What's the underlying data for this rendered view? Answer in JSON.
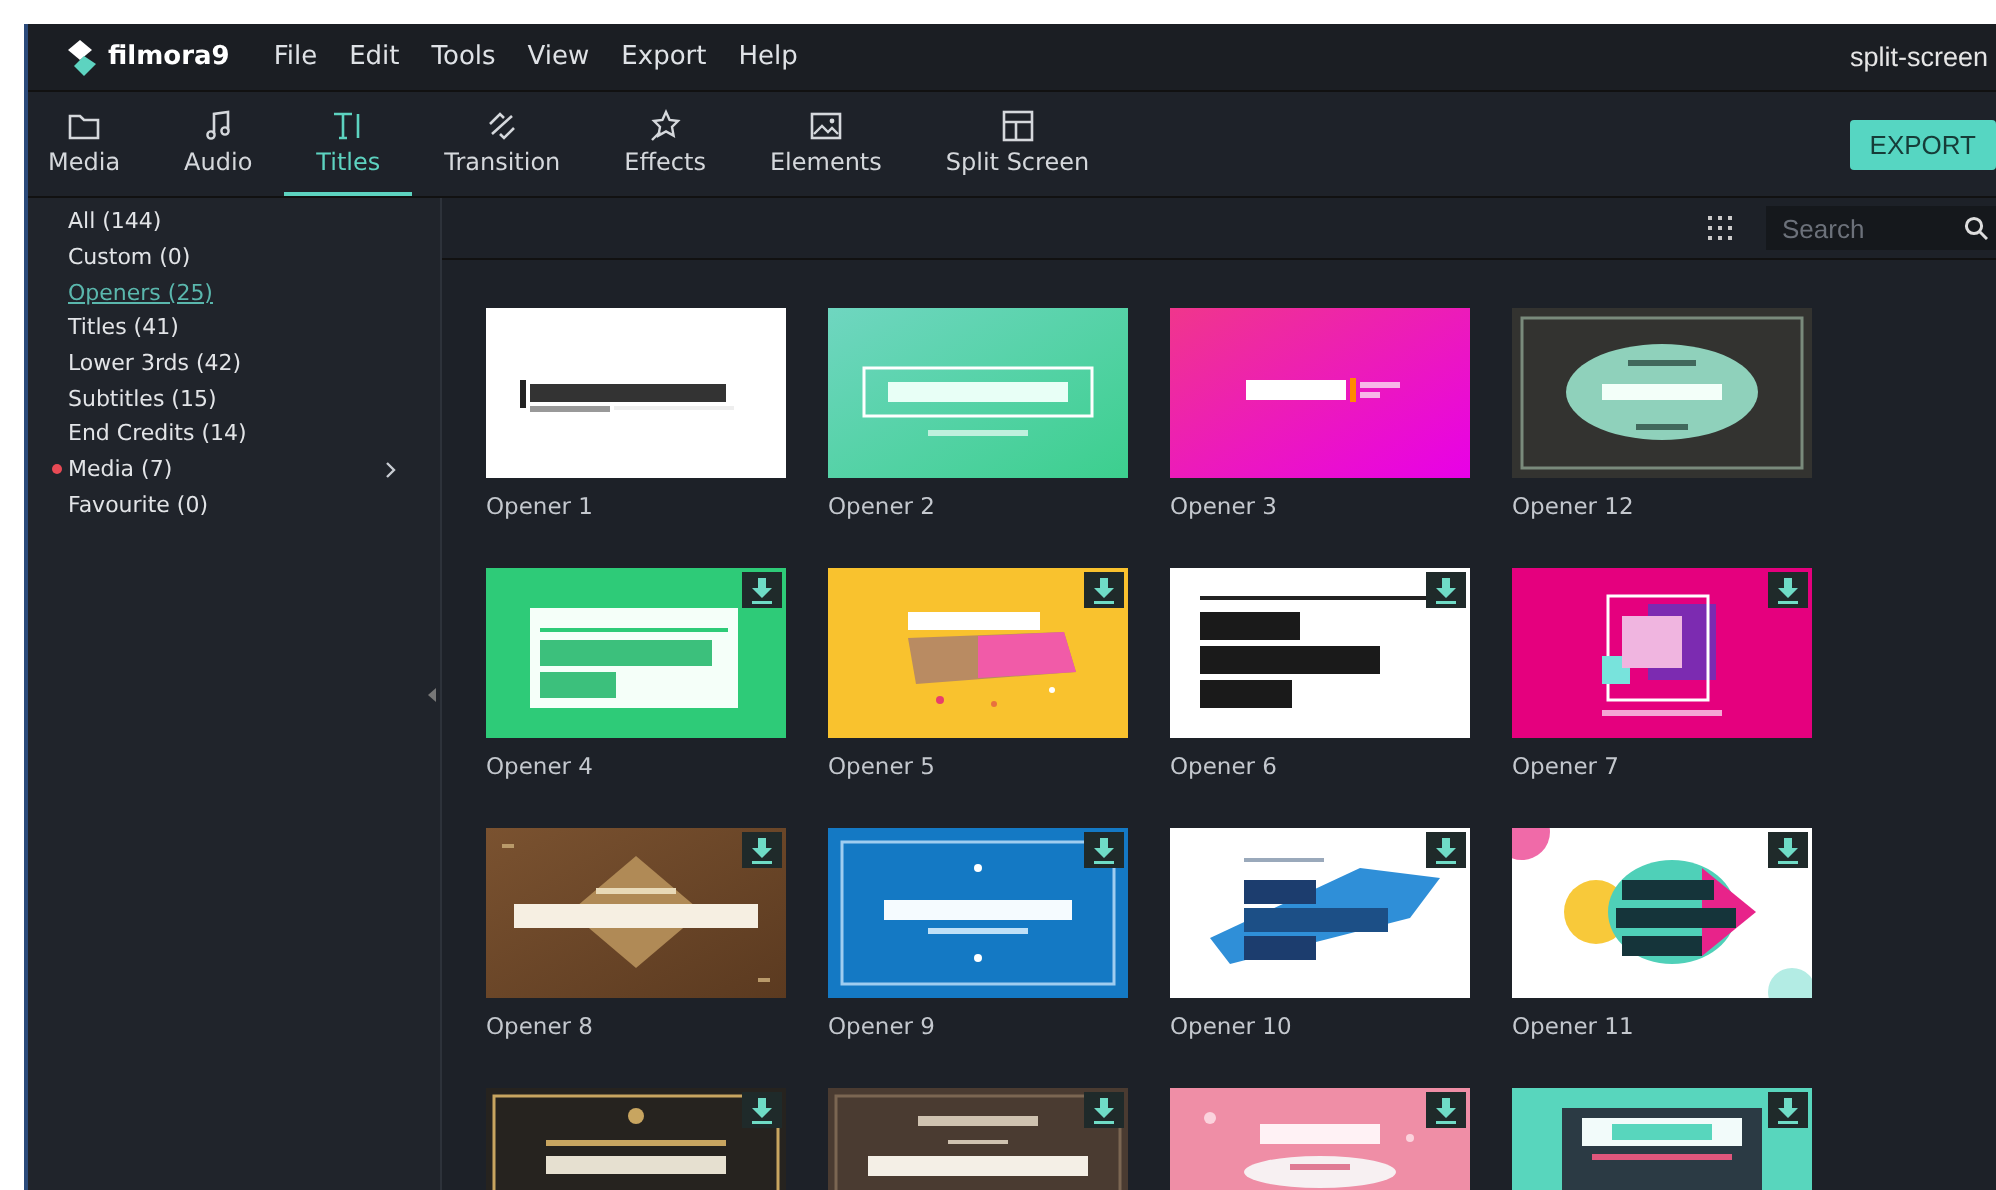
{
  "window": {
    "app_name": "filmora9",
    "menu": [
      "File",
      "Edit",
      "Tools",
      "View",
      "Export",
      "Help"
    ],
    "project_title": "split-screen"
  },
  "toolbar": {
    "tabs": [
      {
        "label": "Media",
        "selected": false
      },
      {
        "label": "Audio",
        "selected": false
      },
      {
        "label": "Titles",
        "selected": true
      },
      {
        "label": "Transition",
        "selected": false
      },
      {
        "label": "Effects",
        "selected": false
      },
      {
        "label": "Elements",
        "selected": false
      },
      {
        "label": "Split Screen",
        "selected": false
      }
    ],
    "export_button": "EXPORT"
  },
  "sidebar": {
    "items": [
      {
        "label": "All (144)",
        "selected": false,
        "new": false,
        "has_submenu": false
      },
      {
        "label": "Custom (0)",
        "selected": false,
        "new": false,
        "has_submenu": false
      },
      {
        "label": "Openers (25)",
        "selected": true,
        "new": false,
        "has_submenu": false
      },
      {
        "label": "Titles (41)",
        "selected": false,
        "new": false,
        "has_submenu": false
      },
      {
        "label": "Lower 3rds (42)",
        "selected": false,
        "new": false,
        "has_submenu": false
      },
      {
        "label": "Subtitles (15)",
        "selected": false,
        "new": false,
        "has_submenu": false
      },
      {
        "label": "End Credits (14)",
        "selected": false,
        "new": false,
        "has_submenu": false
      },
      {
        "label": "Media (7)",
        "selected": false,
        "new": true,
        "has_submenu": true
      },
      {
        "label": "Favourite (0)",
        "selected": false,
        "new": false,
        "has_submenu": false
      }
    ]
  },
  "search": {
    "placeholder": "Search"
  },
  "templates": [
    {
      "label": "Opener 1",
      "downloadable": false
    },
    {
      "label": "Opener 2",
      "downloadable": false
    },
    {
      "label": "Opener 3",
      "downloadable": false
    },
    {
      "label": "Opener 12",
      "downloadable": false
    },
    {
      "label": "Opener 4",
      "downloadable": true
    },
    {
      "label": "Opener 5",
      "downloadable": true
    },
    {
      "label": "Opener 6",
      "downloadable": true
    },
    {
      "label": "Opener 7",
      "downloadable": true
    },
    {
      "label": "Opener 8",
      "downloadable": true
    },
    {
      "label": "Opener 9",
      "downloadable": true
    },
    {
      "label": "Opener 10",
      "downloadable": true
    },
    {
      "label": "Opener 11",
      "downloadable": true
    },
    {
      "downloadable": true
    },
    {
      "downloadable": true
    },
    {
      "downloadable": true
    },
    {
      "downloadable": true
    }
  ]
}
